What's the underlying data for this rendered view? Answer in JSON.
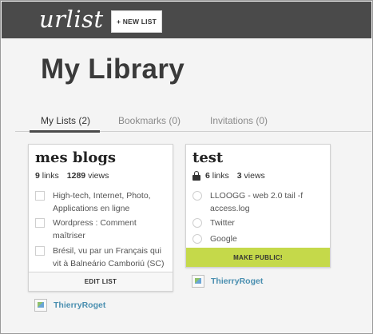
{
  "header": {
    "logo": "urlist",
    "new_list_label": "+ NEW LIST"
  },
  "page_title": "My Library",
  "tabs": [
    {
      "label": "My Lists (2)",
      "active": true
    },
    {
      "label": "Bookmarks (0)",
      "active": false
    },
    {
      "label": "Invitations (0)",
      "active": false
    }
  ],
  "lists": [
    {
      "title": "mes blogs",
      "links_count": "9",
      "links_label": "links",
      "views_count": "1289",
      "views_label": "views",
      "items": [
        {
          "text": "High-tech, Internet, Photo, Applications en ligne"
        },
        {
          "text": "Wordpress : Comment maîtriser"
        },
        {
          "text": "Brésil, vu par un Français qui vit à Balneário Camboriú (SC)"
        }
      ],
      "footer_label": "EDIT LIST",
      "owner": "ThierryRoget"
    },
    {
      "title": "test",
      "private": true,
      "links_count": "6",
      "links_label": "links",
      "views_count": "3",
      "views_label": "views",
      "items": [
        {
          "text": "LLOOGG - web 2.0 tail -f access.log"
        },
        {
          "text": "Twitter"
        },
        {
          "text": "Google"
        }
      ],
      "footer_label": "MAKE PUBLIC!",
      "owner": "ThierryRoget"
    }
  ],
  "colors": {
    "topbar": "#4a4a4a",
    "make_public": "#c5d94a",
    "owner_link": "#4a8fb0"
  }
}
